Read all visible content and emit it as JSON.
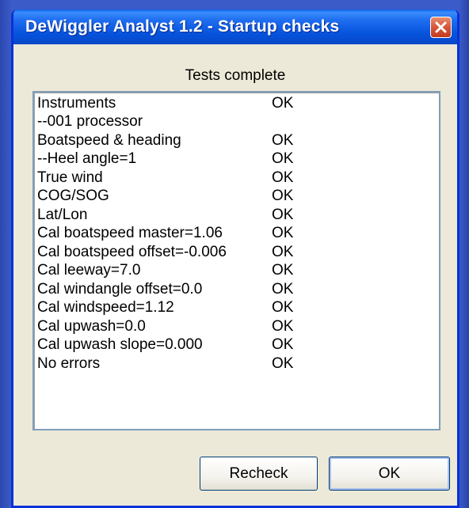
{
  "window": {
    "title": "DeWiggler Analyst 1.2 - Startup checks"
  },
  "status_label": "Tests complete",
  "results": [
    {
      "name": "Instruments",
      "status": "OK"
    },
    {
      "name": "--001 processor",
      "status": ""
    },
    {
      "name": "Boatspeed & heading",
      "status": "OK"
    },
    {
      "name": "--Heel angle=1",
      "status": "OK"
    },
    {
      "name": "True wind",
      "status": "OK"
    },
    {
      "name": "COG/SOG",
      "status": "OK"
    },
    {
      "name": "Lat/Lon",
      "status": "OK"
    },
    {
      "name": "Cal boatspeed master=1.06",
      "status": "OK"
    },
    {
      "name": "Cal boatspeed offset=-0.006",
      "status": "OK"
    },
    {
      "name": "Cal leeway=7.0",
      "status": "OK"
    },
    {
      "name": "Cal windangle offset=0.0",
      "status": "OK"
    },
    {
      "name": "Cal windspeed=1.12",
      "status": "OK"
    },
    {
      "name": "Cal upwash=0.0",
      "status": "OK"
    },
    {
      "name": "Cal upwash slope=0.000",
      "status": "OK"
    },
    {
      "name": "No errors",
      "status": "OK"
    }
  ],
  "buttons": {
    "recheck_label": "Recheck",
    "ok_label": "OK"
  },
  "icons": {
    "close": "close-icon"
  },
  "colors": {
    "titlebar": "#0653dc",
    "close_button": "#d5573a",
    "window_body": "#ece9d8",
    "desktop": "#3b5bc8"
  }
}
